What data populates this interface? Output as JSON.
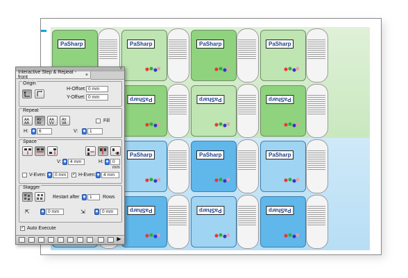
{
  "panel": {
    "title": "Interactive Step & Repeat - front",
    "close_glyph": "×",
    "menu_glyph": "≡",
    "origin": {
      "legend": "Origin",
      "h_offset_label": "H-Offset:",
      "h_offset_value": "0 mm",
      "v_offset_label": "Y-Offset:",
      "v_offset_value": "0 mm"
    },
    "repeat": {
      "legend": "Repeat",
      "fill_label": "Fill",
      "h_label": "H:",
      "h_value": "6",
      "v_label": "V:",
      "v_value": "1"
    },
    "space": {
      "legend": "Space",
      "v_label": "V:",
      "v_value": "4 mm",
      "h_label": "H:",
      "h_value": "0 mm",
      "v_even_label": "V-Even:",
      "v_even_value": "0 mm",
      "h_even_label": "H-Even:",
      "h_even_value": "4 mm",
      "h_even_checked": true
    },
    "stagger": {
      "legend": "Stagger",
      "restart_label": "Restart after",
      "restart_value": "1",
      "rows_label": "Rows",
      "shift1_value": "0 mm",
      "shift2_value": "0 mm"
    },
    "auto_execute_label": "Auto Execute",
    "auto_execute_checked": true
  },
  "document": {
    "logo_text": "PaSharp",
    "crop_colors": [
      "#00a7e1",
      "#e6007e",
      "#ffe500",
      "#111111",
      "#00a7e1",
      "#e6007e",
      "#ffe500",
      "#111111",
      "#00a7e1",
      "#e6007e",
      "#ffe500",
      "#111111",
      "#00a7e1",
      "#e6007e",
      "#ffe500",
      "#111111",
      "#00a7e1",
      "#e6007e",
      "#ffe500",
      "#111111",
      "#00a7e1",
      "#e6007e",
      "#ffe500",
      "#111111",
      "#00a7e1",
      "#e6007e",
      "#ffe500",
      "#111111",
      "#00a7e1",
      "#e6007e",
      "#ffe500",
      "#111111",
      "#00a7e1",
      "#e6007e"
    ]
  },
  "colors": {
    "green": "#8fd37e",
    "blue": "#5fb7ea",
    "spinner": "#3b7be8"
  }
}
